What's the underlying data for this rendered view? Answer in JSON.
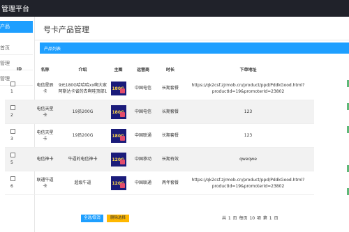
{
  "app": {
    "title": "管理平台"
  },
  "sidebar": {
    "active": "产品",
    "items": [
      "首页",
      "管理",
      "管理"
    ]
  },
  "page": {
    "title": "号卡产品管理",
    "list_label": "产品列表"
  },
  "table": {
    "headers": [
      "ID",
      "名称",
      "介绍",
      "主图",
      "运营商",
      "时长",
      "下单地址"
    ],
    "rows": [
      {
        "id": "1",
        "name": "电信星辰卡",
        "intro": "9元180G哈哈哈xx啊大家阿斯达卡省的去啊哇顶部1",
        "thumb": "180G",
        "carrier": "中国电信",
        "duration": "长期套餐",
        "url": "https://qk2csf.zjrmob.cn/product/ppd/PddkGood.html?productId=19&promoterId=23802"
      },
      {
        "id": "2",
        "name": "电信天星卡",
        "intro": "19员200G",
        "thumb": "180G",
        "carrier": "中国电信",
        "duration": "长期套餐",
        "url": "123"
      },
      {
        "id": "3",
        "name": "电信天星卡",
        "intro": "19员200G",
        "thumb": "180G",
        "carrier": "中国联通",
        "duration": "长期套餐",
        "url": "123"
      },
      {
        "id": "5",
        "name": "电信神卡",
        "intro": "牛逼的电信神卡",
        "thumb": "120G",
        "carrier": "中国移动",
        "duration": "长期有效",
        "url": "qweqwe"
      },
      {
        "id": "6",
        "name": "联通牛逼卡",
        "intro": "超级牛逼",
        "thumb": "120G",
        "carrier": "中国联通",
        "duration": "两年套餐",
        "url": "https://qk2csf.zjrmob.cn/product/ppd/PddkGood.html?productId=19&promoterId=23802"
      }
    ]
  },
  "actions": {
    "select_all": "全选/取消",
    "delete": "删除选择"
  },
  "pager": {
    "text": "共 1 页  每页 10 项  第 1 页"
  },
  "colors": {
    "accent": "#1e9fff",
    "topbar": "#20222a",
    "warn": "#ffb800",
    "success_edge": "#5fb878"
  }
}
